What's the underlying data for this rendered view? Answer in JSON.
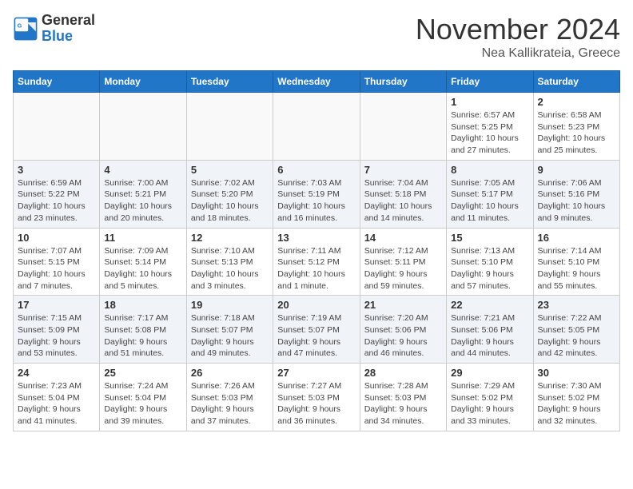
{
  "header": {
    "logo_general": "General",
    "logo_blue": "Blue",
    "month": "November 2024",
    "location": "Nea Kallikrateia, Greece"
  },
  "weekdays": [
    "Sunday",
    "Monday",
    "Tuesday",
    "Wednesday",
    "Thursday",
    "Friday",
    "Saturday"
  ],
  "weeks": [
    [
      {
        "day": "",
        "info": ""
      },
      {
        "day": "",
        "info": ""
      },
      {
        "day": "",
        "info": ""
      },
      {
        "day": "",
        "info": ""
      },
      {
        "day": "",
        "info": ""
      },
      {
        "day": "1",
        "info": "Sunrise: 6:57 AM\nSunset: 5:25 PM\nDaylight: 10 hours and 27 minutes."
      },
      {
        "day": "2",
        "info": "Sunrise: 6:58 AM\nSunset: 5:23 PM\nDaylight: 10 hours and 25 minutes."
      }
    ],
    [
      {
        "day": "3",
        "info": "Sunrise: 6:59 AM\nSunset: 5:22 PM\nDaylight: 10 hours and 23 minutes."
      },
      {
        "day": "4",
        "info": "Sunrise: 7:00 AM\nSunset: 5:21 PM\nDaylight: 10 hours and 20 minutes."
      },
      {
        "day": "5",
        "info": "Sunrise: 7:02 AM\nSunset: 5:20 PM\nDaylight: 10 hours and 18 minutes."
      },
      {
        "day": "6",
        "info": "Sunrise: 7:03 AM\nSunset: 5:19 PM\nDaylight: 10 hours and 16 minutes."
      },
      {
        "day": "7",
        "info": "Sunrise: 7:04 AM\nSunset: 5:18 PM\nDaylight: 10 hours and 14 minutes."
      },
      {
        "day": "8",
        "info": "Sunrise: 7:05 AM\nSunset: 5:17 PM\nDaylight: 10 hours and 11 minutes."
      },
      {
        "day": "9",
        "info": "Sunrise: 7:06 AM\nSunset: 5:16 PM\nDaylight: 10 hours and 9 minutes."
      }
    ],
    [
      {
        "day": "10",
        "info": "Sunrise: 7:07 AM\nSunset: 5:15 PM\nDaylight: 10 hours and 7 minutes."
      },
      {
        "day": "11",
        "info": "Sunrise: 7:09 AM\nSunset: 5:14 PM\nDaylight: 10 hours and 5 minutes."
      },
      {
        "day": "12",
        "info": "Sunrise: 7:10 AM\nSunset: 5:13 PM\nDaylight: 10 hours and 3 minutes."
      },
      {
        "day": "13",
        "info": "Sunrise: 7:11 AM\nSunset: 5:12 PM\nDaylight: 10 hours and 1 minute."
      },
      {
        "day": "14",
        "info": "Sunrise: 7:12 AM\nSunset: 5:11 PM\nDaylight: 9 hours and 59 minutes."
      },
      {
        "day": "15",
        "info": "Sunrise: 7:13 AM\nSunset: 5:10 PM\nDaylight: 9 hours and 57 minutes."
      },
      {
        "day": "16",
        "info": "Sunrise: 7:14 AM\nSunset: 5:10 PM\nDaylight: 9 hours and 55 minutes."
      }
    ],
    [
      {
        "day": "17",
        "info": "Sunrise: 7:15 AM\nSunset: 5:09 PM\nDaylight: 9 hours and 53 minutes."
      },
      {
        "day": "18",
        "info": "Sunrise: 7:17 AM\nSunset: 5:08 PM\nDaylight: 9 hours and 51 minutes."
      },
      {
        "day": "19",
        "info": "Sunrise: 7:18 AM\nSunset: 5:07 PM\nDaylight: 9 hours and 49 minutes."
      },
      {
        "day": "20",
        "info": "Sunrise: 7:19 AM\nSunset: 5:07 PM\nDaylight: 9 hours and 47 minutes."
      },
      {
        "day": "21",
        "info": "Sunrise: 7:20 AM\nSunset: 5:06 PM\nDaylight: 9 hours and 46 minutes."
      },
      {
        "day": "22",
        "info": "Sunrise: 7:21 AM\nSunset: 5:06 PM\nDaylight: 9 hours and 44 minutes."
      },
      {
        "day": "23",
        "info": "Sunrise: 7:22 AM\nSunset: 5:05 PM\nDaylight: 9 hours and 42 minutes."
      }
    ],
    [
      {
        "day": "24",
        "info": "Sunrise: 7:23 AM\nSunset: 5:04 PM\nDaylight: 9 hours and 41 minutes."
      },
      {
        "day": "25",
        "info": "Sunrise: 7:24 AM\nSunset: 5:04 PM\nDaylight: 9 hours and 39 minutes."
      },
      {
        "day": "26",
        "info": "Sunrise: 7:26 AM\nSunset: 5:03 PM\nDaylight: 9 hours and 37 minutes."
      },
      {
        "day": "27",
        "info": "Sunrise: 7:27 AM\nSunset: 5:03 PM\nDaylight: 9 hours and 36 minutes."
      },
      {
        "day": "28",
        "info": "Sunrise: 7:28 AM\nSunset: 5:03 PM\nDaylight: 9 hours and 34 minutes."
      },
      {
        "day": "29",
        "info": "Sunrise: 7:29 AM\nSunset: 5:02 PM\nDaylight: 9 hours and 33 minutes."
      },
      {
        "day": "30",
        "info": "Sunrise: 7:30 AM\nSunset: 5:02 PM\nDaylight: 9 hours and 32 minutes."
      }
    ]
  ]
}
